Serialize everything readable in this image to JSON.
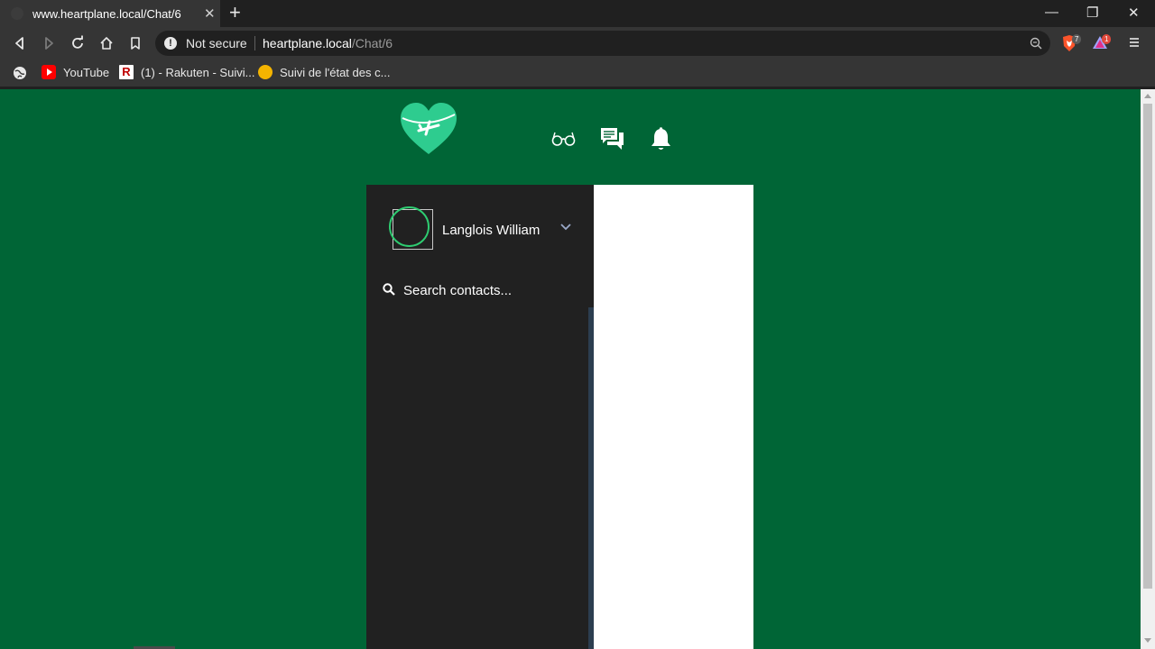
{
  "browser": {
    "tab_title": "www.heartplane.local/Chat/6",
    "tab_close": "✕",
    "new_tab": "+",
    "window_controls": {
      "minimize": "—",
      "restore": "❐",
      "close": "✕"
    },
    "address": {
      "security_label": "Not secure",
      "host": "heartplane.local",
      "path": "/Chat/6"
    },
    "brave_badge": "7",
    "rewards_badge": "1",
    "bookmarks": [
      {
        "label": "YouTube",
        "icon": "youtube-icon"
      },
      {
        "label": "(1) - Rakuten - Suivi...",
        "icon": "rakuten-icon"
      },
      {
        "label": "Suivi de l'état des c...",
        "icon": "tracking-icon"
      }
    ]
  },
  "app": {
    "brand_color": "#006536",
    "header_icons": [
      "glasses-icon",
      "chat-icon",
      "bell-icon"
    ],
    "user": {
      "name": "Langlois William"
    },
    "search": {
      "placeholder": "Search contacts..."
    }
  }
}
